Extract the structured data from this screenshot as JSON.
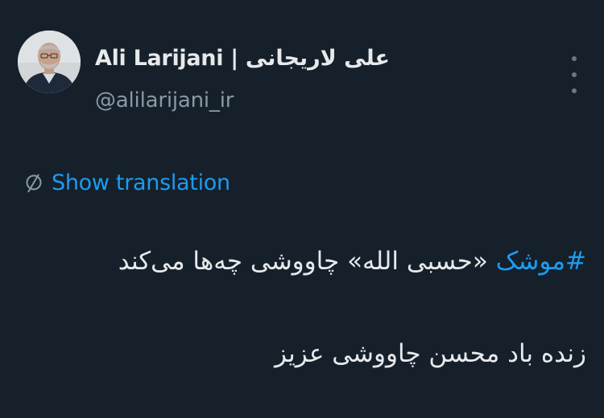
{
  "colors": {
    "background": "#15202b",
    "primary_text": "#e7e9ea",
    "secondary_text": "#8b98a5",
    "accent": "#1d9bf0"
  },
  "author": {
    "display_name": "Ali Larijani | علی لاریجانی",
    "handle": "@alilarijani_ir",
    "avatar_icon": "profile-photo"
  },
  "actions": {
    "more_icon": "vertical-ellipsis-icon",
    "translation_icon": "globe-icon",
    "show_translation_label": "Show translation"
  },
  "tweet": {
    "hashtag": "#موشک",
    "line1_rest": " «حسبی الله» چاووشی چه‌ها می‌کند",
    "line2": "زنده باد محسن چاووشی عزیز"
  }
}
